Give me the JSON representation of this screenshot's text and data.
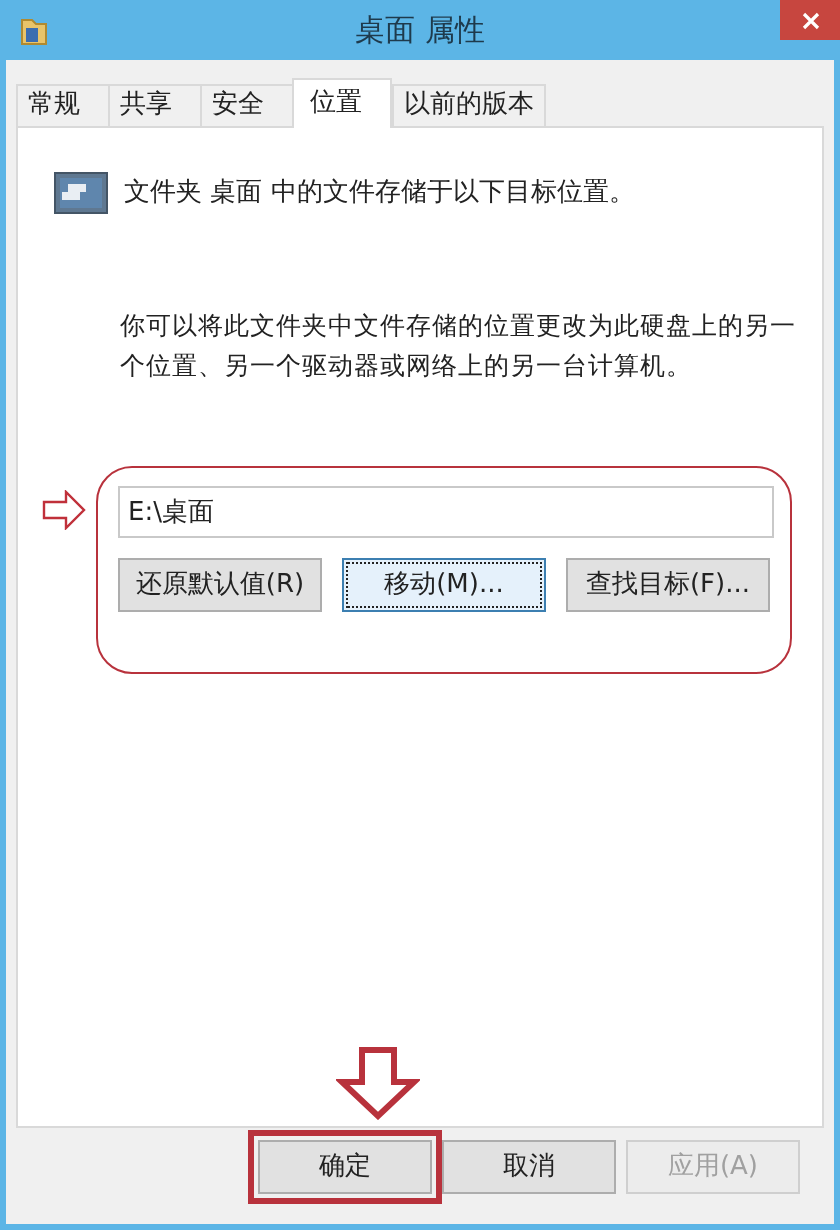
{
  "window": {
    "title": "桌面 属性"
  },
  "tabs": [
    {
      "label": "常规",
      "selected": false
    },
    {
      "label": "共享",
      "selected": false
    },
    {
      "label": "安全",
      "selected": false
    },
    {
      "label": "位置",
      "selected": true
    },
    {
      "label": "以前的版本",
      "selected": false
    }
  ],
  "info": "文件夹 桌面 中的文件存储于以下目标位置。",
  "description": "你可以将此文件夹中文件存储的位置更改为此硬盘上的另一个位置、另一个驱动器或网络上的另一台计算机。",
  "path_field": {
    "value": "E:\\桌面"
  },
  "location_buttons": [
    {
      "label": "还原默认值(R)",
      "focused": false
    },
    {
      "label": "移动(M)...",
      "focused": true
    },
    {
      "label": "查找目标(F)...",
      "focused": false
    }
  ],
  "dialog_buttons": [
    {
      "label": "确定",
      "disabled": false
    },
    {
      "label": "取消",
      "disabled": false
    },
    {
      "label": "应用(A)",
      "disabled": true
    }
  ]
}
